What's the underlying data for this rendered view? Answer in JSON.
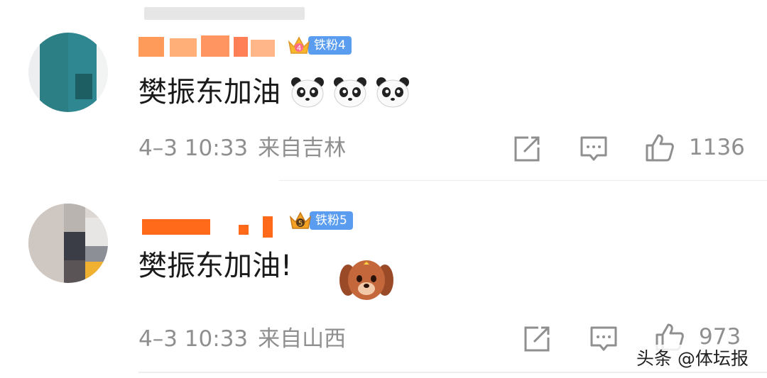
{
  "comments": [
    {
      "badge": "铁粉4",
      "text": "樊振东加油",
      "emojis": [
        "panda-emoji",
        "panda-emoji",
        "panda-emoji"
      ],
      "date": "4–3 10:33",
      "location": "来自吉林",
      "likes": "1136"
    },
    {
      "badge": "铁粉5",
      "text": "樊振东加油!",
      "emojis": [
        "puppy-emoji"
      ],
      "date": "4–3 10:33",
      "location": "来自山西",
      "likes": "973"
    }
  ],
  "watermark": "头条 @体坛报",
  "colors": {
    "badge": "#5a9df0",
    "meta_text": "#8f8f8f",
    "username_orange": "#ff6a1a"
  }
}
